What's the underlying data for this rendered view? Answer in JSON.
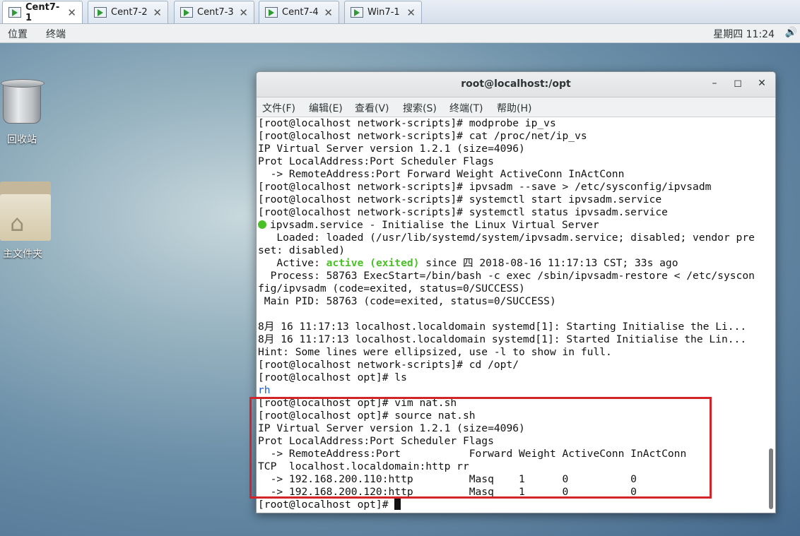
{
  "tabs": [
    {
      "label": "Cent7-1",
      "active": true
    },
    {
      "label": "Cent7-2",
      "active": false
    },
    {
      "label": "Cent7-3",
      "active": false
    },
    {
      "label": "Cent7-4",
      "active": false
    },
    {
      "label": "Win7-1",
      "active": false
    }
  ],
  "panel": {
    "places": "位置",
    "terminal": "终端",
    "clock": "星期四 11:24"
  },
  "desktop": {
    "trash_label": "回收站",
    "home_label": "主文件夹"
  },
  "window": {
    "title": "root@localhost:/opt",
    "menu": [
      "文件(F)",
      "编辑(E)",
      "查看(V)",
      "搜索(S)",
      "终端(T)",
      "帮助(H)"
    ]
  },
  "terminal": {
    "lines": [
      "[root@localhost network-scripts]# modprobe ip_vs",
      "[root@localhost network-scripts]# cat /proc/net/ip_vs",
      "IP Virtual Server version 1.2.1 (size=4096)",
      "Prot LocalAddress:Port Scheduler Flags",
      "  -> RemoteAddress:Port Forward Weight ActiveConn InActConn",
      "[root@localhost network-scripts]# ipvsadm --save > /etc/sysconfig/ipvsadm",
      "[root@localhost network-scripts]# systemctl start ipvsadm.service",
      "[root@localhost network-scripts]# systemctl status ipvsadm.service",
      "ipvsadm.service - Initialise the Linux Virtual Server",
      "   Loaded: loaded (/usr/lib/systemd/system/ipvsadm.service; disabled; vendor pre",
      "set: disabled)",
      "   Active: ",
      "active (exited)",
      " since 四 2018-08-16 11:17:13 CST; 33s ago",
      "  Process: 58763 ExecStart=/bin/bash -c exec /sbin/ipvsadm-restore < /etc/syscon",
      "fig/ipvsadm (code=exited, status=0/SUCCESS)",
      " Main PID: 58763 (code=exited, status=0/SUCCESS)",
      "",
      "8月 16 11:17:13 localhost.localdomain systemd[1]: Starting Initialise the Li...",
      "8月 16 11:17:13 localhost.localdomain systemd[1]: Started Initialise the Lin...",
      "Hint: Some lines were ellipsized, use -l to show in full.",
      "[root@localhost network-scripts]# cd /opt/",
      "[root@localhost opt]# ls",
      "rh",
      "[root@localhost opt]# vim nat.sh",
      "[root@localhost opt]# source nat.sh",
      "IP Virtual Server version 1.2.1 (size=4096)",
      "Prot LocalAddress:Port Scheduler Flags",
      "  -> RemoteAddress:Port           Forward Weight ActiveConn InActConn",
      "TCP  localhost.localdomain:http rr",
      "  -> 192.168.200.110:http         Masq    1      0          0",
      "  -> 192.168.200.120:http         Masq    1      0          0",
      "[root@localhost opt]# "
    ]
  }
}
